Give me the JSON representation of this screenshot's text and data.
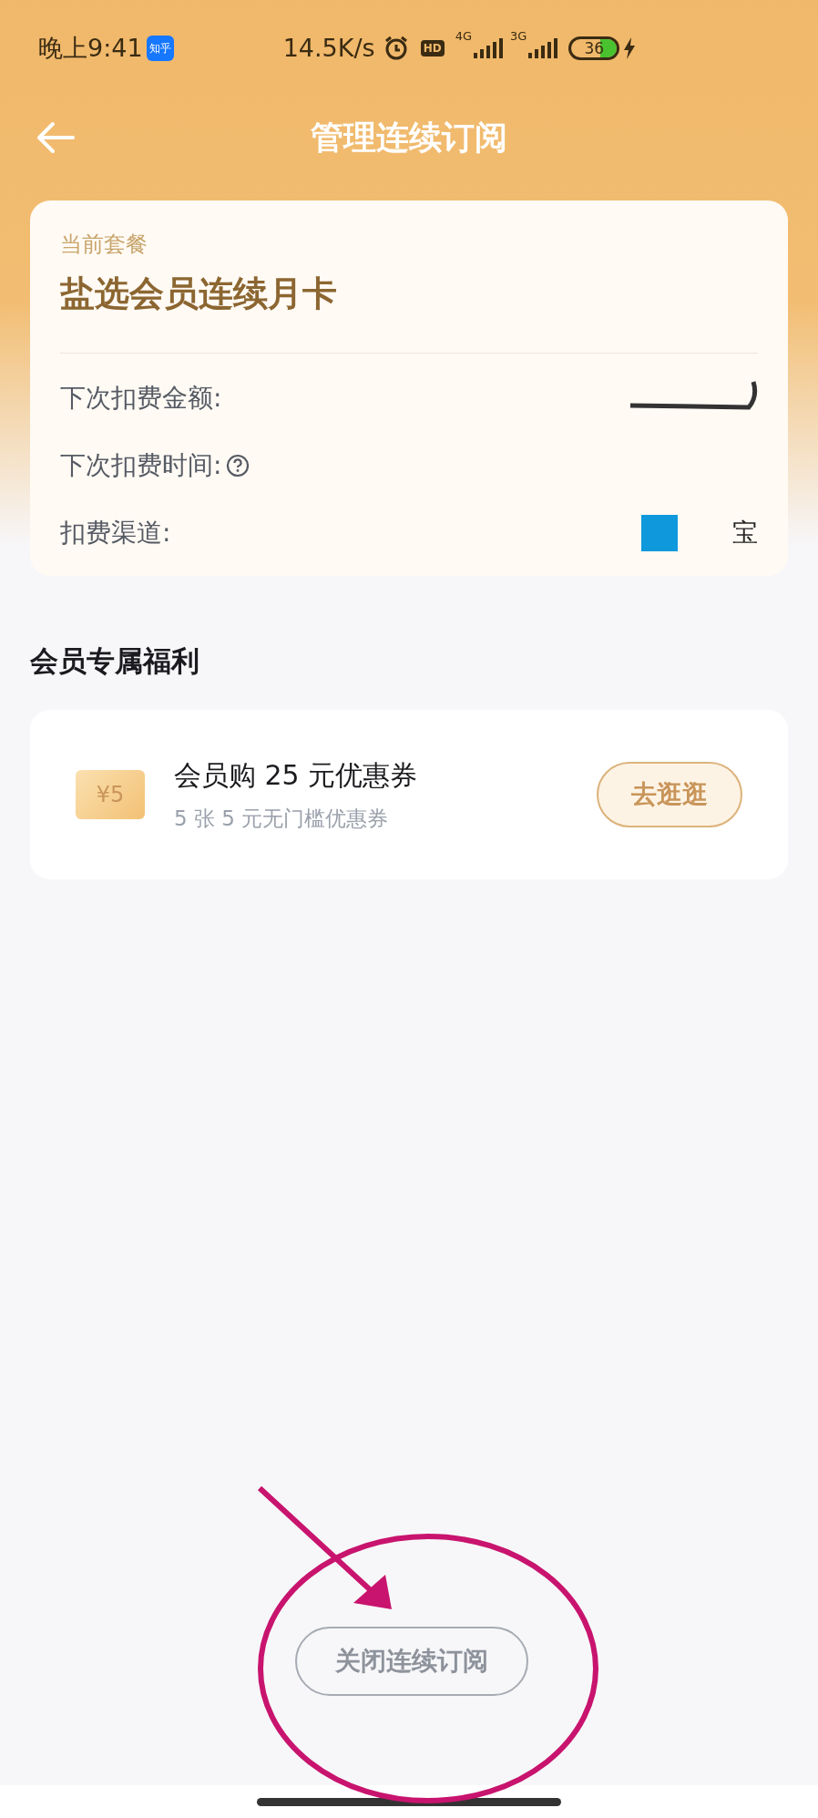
{
  "status_bar": {
    "time": "晚上9:41",
    "app_badge": "知乎",
    "speed": "14.5K/s",
    "hd": "HD",
    "network_1": "4G",
    "network_2": "3G",
    "battery": {
      "text": "36",
      "level": 0.36
    }
  },
  "header": {
    "title": "管理连续订阅"
  },
  "plan": {
    "label": "当前套餐",
    "name": "盐选会员连续月卡",
    "rows": [
      {
        "kind": "redacted",
        "label": "下次扣费金额:"
      },
      {
        "kind": "help",
        "label": "下次扣费时间:"
      },
      {
        "kind": "channel",
        "label": "扣费渠道:",
        "value": "宝"
      }
    ]
  },
  "benefits": {
    "title": "会员专属福利",
    "items": [
      {
        "badge": "¥5",
        "title": "会员购 25 元优惠券",
        "subtitle": "5 张 5 元无门槛优惠券",
        "action": "去逛逛"
      }
    ]
  },
  "footer": {
    "button": "关闭连续订阅"
  }
}
